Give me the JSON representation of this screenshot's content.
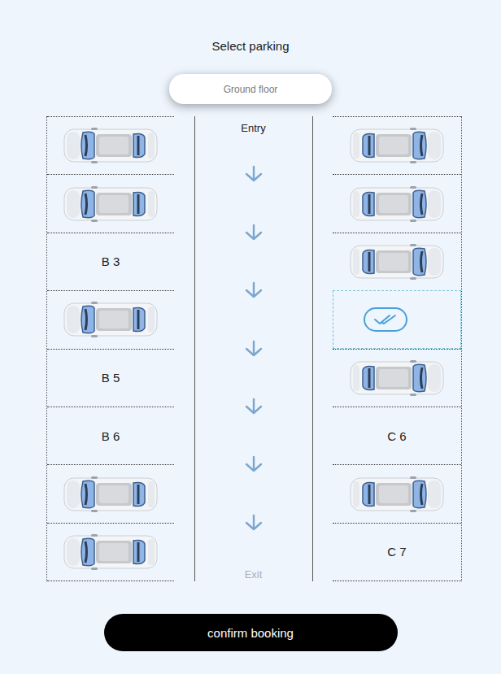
{
  "title": "Select parking",
  "floor": {
    "label": "Ground floor"
  },
  "lane": {
    "entry": "Entry",
    "exit": "Exit"
  },
  "left_slots": [
    {
      "occupied": true,
      "selected": false
    },
    {
      "occupied": true,
      "selected": false
    },
    {
      "occupied": false,
      "selected": false,
      "label": "B 3"
    },
    {
      "occupied": true,
      "selected": false
    },
    {
      "occupied": false,
      "selected": false,
      "label": "B 5"
    },
    {
      "occupied": false,
      "selected": false,
      "label": "B 6"
    },
    {
      "occupied": true,
      "selected": false
    },
    {
      "occupied": true,
      "selected": false
    }
  ],
  "right_slots": [
    {
      "occupied": true,
      "selected": false
    },
    {
      "occupied": true,
      "selected": false
    },
    {
      "occupied": true,
      "selected": false
    },
    {
      "occupied": false,
      "selected": true
    },
    {
      "occupied": true,
      "selected": false
    },
    {
      "occupied": false,
      "selected": false,
      "label": "C 6"
    },
    {
      "occupied": true,
      "selected": false
    },
    {
      "occupied": false,
      "selected": false,
      "label": "C 7"
    }
  ],
  "button": {
    "label": "confirm booking"
  }
}
